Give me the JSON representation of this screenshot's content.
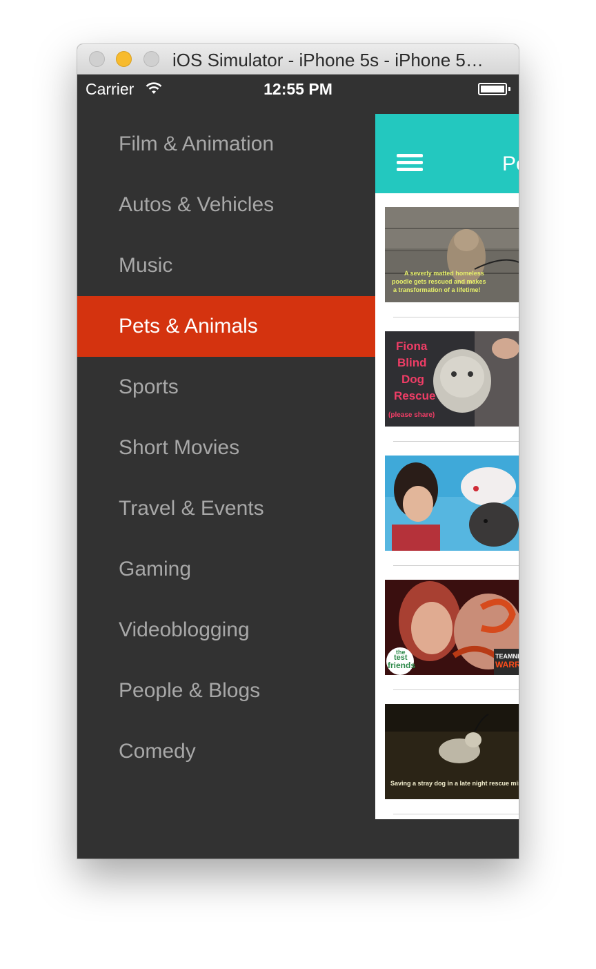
{
  "window": {
    "title": "iOS Simulator - iPhone 5s - iPhone 5…"
  },
  "status_bar": {
    "carrier": "Carrier",
    "time": "12:55 PM",
    "battery_level": 1.0
  },
  "menu": {
    "items": [
      {
        "label": "Film & Animation",
        "active": false
      },
      {
        "label": "Autos & Vehicles",
        "active": false
      },
      {
        "label": "Music",
        "active": false
      },
      {
        "label": "Pets & Animals",
        "active": true
      },
      {
        "label": "Sports",
        "active": false
      },
      {
        "label": "Short Movies",
        "active": false
      },
      {
        "label": "Travel & Events",
        "active": false
      },
      {
        "label": "Gaming",
        "active": false
      },
      {
        "label": "Videoblogging",
        "active": false
      },
      {
        "label": "People & Blogs",
        "active": false
      },
      {
        "label": "Comedy",
        "active": false
      }
    ]
  },
  "navbar": {
    "title_fragment": "Pe",
    "menu_icon": "hamburger-icon"
  },
  "videos": [
    {
      "caption_line1": "A severly matted homeless",
      "caption_line2": "poodle gets rescued and makes",
      "caption_line3": "a transformation of a lifetime!"
    },
    {
      "caption_line1": "Fiona",
      "caption_line2": "Blind",
      "caption_line3": "Dog",
      "caption_line4": "Rescue",
      "caption_line5": "(please share)"
    },
    {},
    {
      "logo_line1": "the",
      "logo_line2": "test",
      "logo_line3": "friends",
      "logo_right1": "TEAMNI",
      "logo_right2": "WARRI"
    },
    {
      "caption_line1": "Saving a stray dog in a late night rescue missio"
    }
  ],
  "colors": {
    "drawer_background": "#323232",
    "active_item": "#d4330f",
    "navbar": "#23c8bf",
    "inactive_text": "#a8a8a8"
  }
}
